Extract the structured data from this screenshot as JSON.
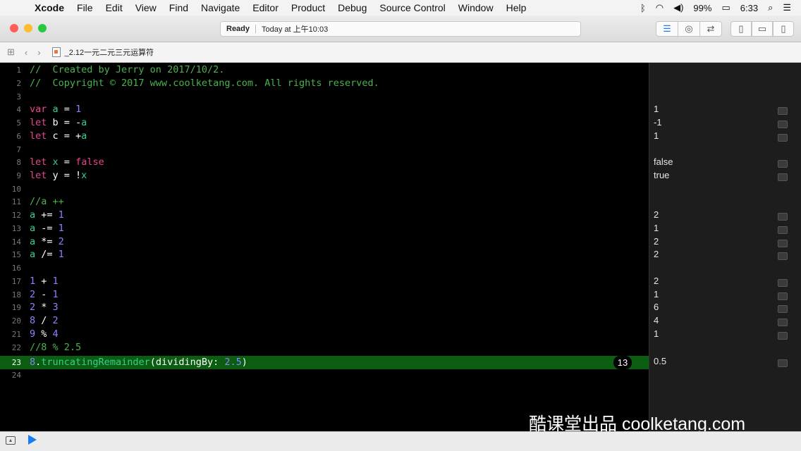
{
  "menubar": {
    "apple": "",
    "app": "Xcode",
    "items": [
      "File",
      "Edit",
      "View",
      "Find",
      "Navigate",
      "Editor",
      "Product",
      "Debug",
      "Source Control",
      "Window",
      "Help"
    ],
    "battery": "99%",
    "time": "6:33"
  },
  "toolbar": {
    "status_ready": "Ready",
    "status_time": "Today at 上午10:03"
  },
  "jumpbar": {
    "filename": "_2.12一元二元三元运算符"
  },
  "editor": {
    "current_line": 23,
    "lines": [
      {
        "n": "1",
        "t": "//  Created by Jerry on 2017/10/2."
      },
      {
        "n": "2",
        "t": "//  Copyright © 2017 www.coolketang.com. All rights reserved."
      },
      {
        "n": "3",
        "t": ""
      },
      {
        "n": "4",
        "t": "var a = 1"
      },
      {
        "n": "5",
        "t": "let b = -a"
      },
      {
        "n": "6",
        "t": "let c = +a"
      },
      {
        "n": "7",
        "t": ""
      },
      {
        "n": "8",
        "t": "let x = false"
      },
      {
        "n": "9",
        "t": "let y = !x"
      },
      {
        "n": "10",
        "t": ""
      },
      {
        "n": "11",
        "t": "//a ++"
      },
      {
        "n": "12",
        "t": "a += 1"
      },
      {
        "n": "13",
        "t": "a -= 1"
      },
      {
        "n": "14",
        "t": "a *= 2"
      },
      {
        "n": "15",
        "t": "a /= 1"
      },
      {
        "n": "16",
        "t": ""
      },
      {
        "n": "17",
        "t": "1 + 1"
      },
      {
        "n": "18",
        "t": "2 - 1"
      },
      {
        "n": "19",
        "t": "2 * 3"
      },
      {
        "n": "20",
        "t": "8 / 2"
      },
      {
        "n": "21",
        "t": "9 % 4"
      },
      {
        "n": "22",
        "t": "//8 % 2.5"
      },
      {
        "n": "23",
        "t": "8.truncatingRemainder(dividingBy: 2.5)"
      },
      {
        "n": "24",
        "t": ""
      }
    ],
    "bubble": "13"
  },
  "results": [
    "",
    "",
    "",
    "1",
    "-1",
    "1",
    "",
    "false",
    "true",
    "",
    "",
    "2",
    "1",
    "2",
    "2",
    "",
    "2",
    "1",
    "6",
    "4",
    "1",
    "",
    "0.5",
    ""
  ],
  "watermark": "酷课堂出品 coolketang.com"
}
